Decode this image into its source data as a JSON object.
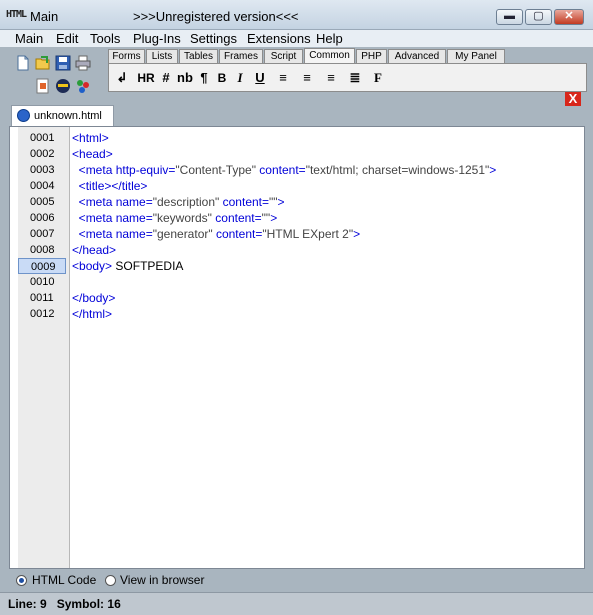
{
  "window": {
    "app_icon_text": "HTML",
    "title": "Main",
    "center_title": ">>>Unregistered version<<<",
    "minimize": "▬",
    "maximize": "▢",
    "close": "✕"
  },
  "menu": [
    "Main",
    "Edit",
    "Tools",
    "Plug-Ins",
    "Settings",
    "Extensions",
    "Help"
  ],
  "tabs": [
    "Forms",
    "Lists",
    "Tables",
    "Frames",
    "Script",
    "Common",
    "PHP",
    "Advanced",
    "My Panel"
  ],
  "active_tab": "Common",
  "format_buttons": [
    "↲",
    "HR",
    "#",
    "nb",
    "¶",
    "B",
    "I",
    "U",
    "≡",
    "≡",
    "≡",
    "≣",
    "F"
  ],
  "close_panel_label": "X",
  "document_tab": "unknown.html",
  "lines": [
    {
      "num": "0001",
      "text": "<html>"
    },
    {
      "num": "0002",
      "text": "<head>"
    },
    {
      "num": "0003",
      "text": "  <meta http-equiv=\"Content-Type\" content=\"text/html; charset=windows-1251\">"
    },
    {
      "num": "0004",
      "text": "  <title></title>"
    },
    {
      "num": "0005",
      "text": "  <meta name=\"description\" content=\"\">"
    },
    {
      "num": "0006",
      "text": "  <meta name=\"keywords\" content=\"\">"
    },
    {
      "num": "0007",
      "text": "  <meta name=\"generator\" content=\"HTML EXpert 2\">"
    },
    {
      "num": "0008",
      "text": "</head>"
    },
    {
      "num": "0009",
      "text": "<body> SOFTPEDIA"
    },
    {
      "num": "0010",
      "text": ""
    },
    {
      "num": "0011",
      "text": "</body>"
    },
    {
      "num": "0012",
      "text": "</html>"
    }
  ],
  "current_line": "0009",
  "view_options": {
    "html_code": "HTML Code",
    "view_in_browser": "View in browser",
    "selected": "HTML Code"
  },
  "status": {
    "line_label": "Line:",
    "line": "9",
    "symbol_label": "Symbol:",
    "symbol": "16"
  },
  "colors": {
    "tag": "#0000d8",
    "attr_value": "#444444",
    "current_line_bg": "#c9dbf6"
  }
}
